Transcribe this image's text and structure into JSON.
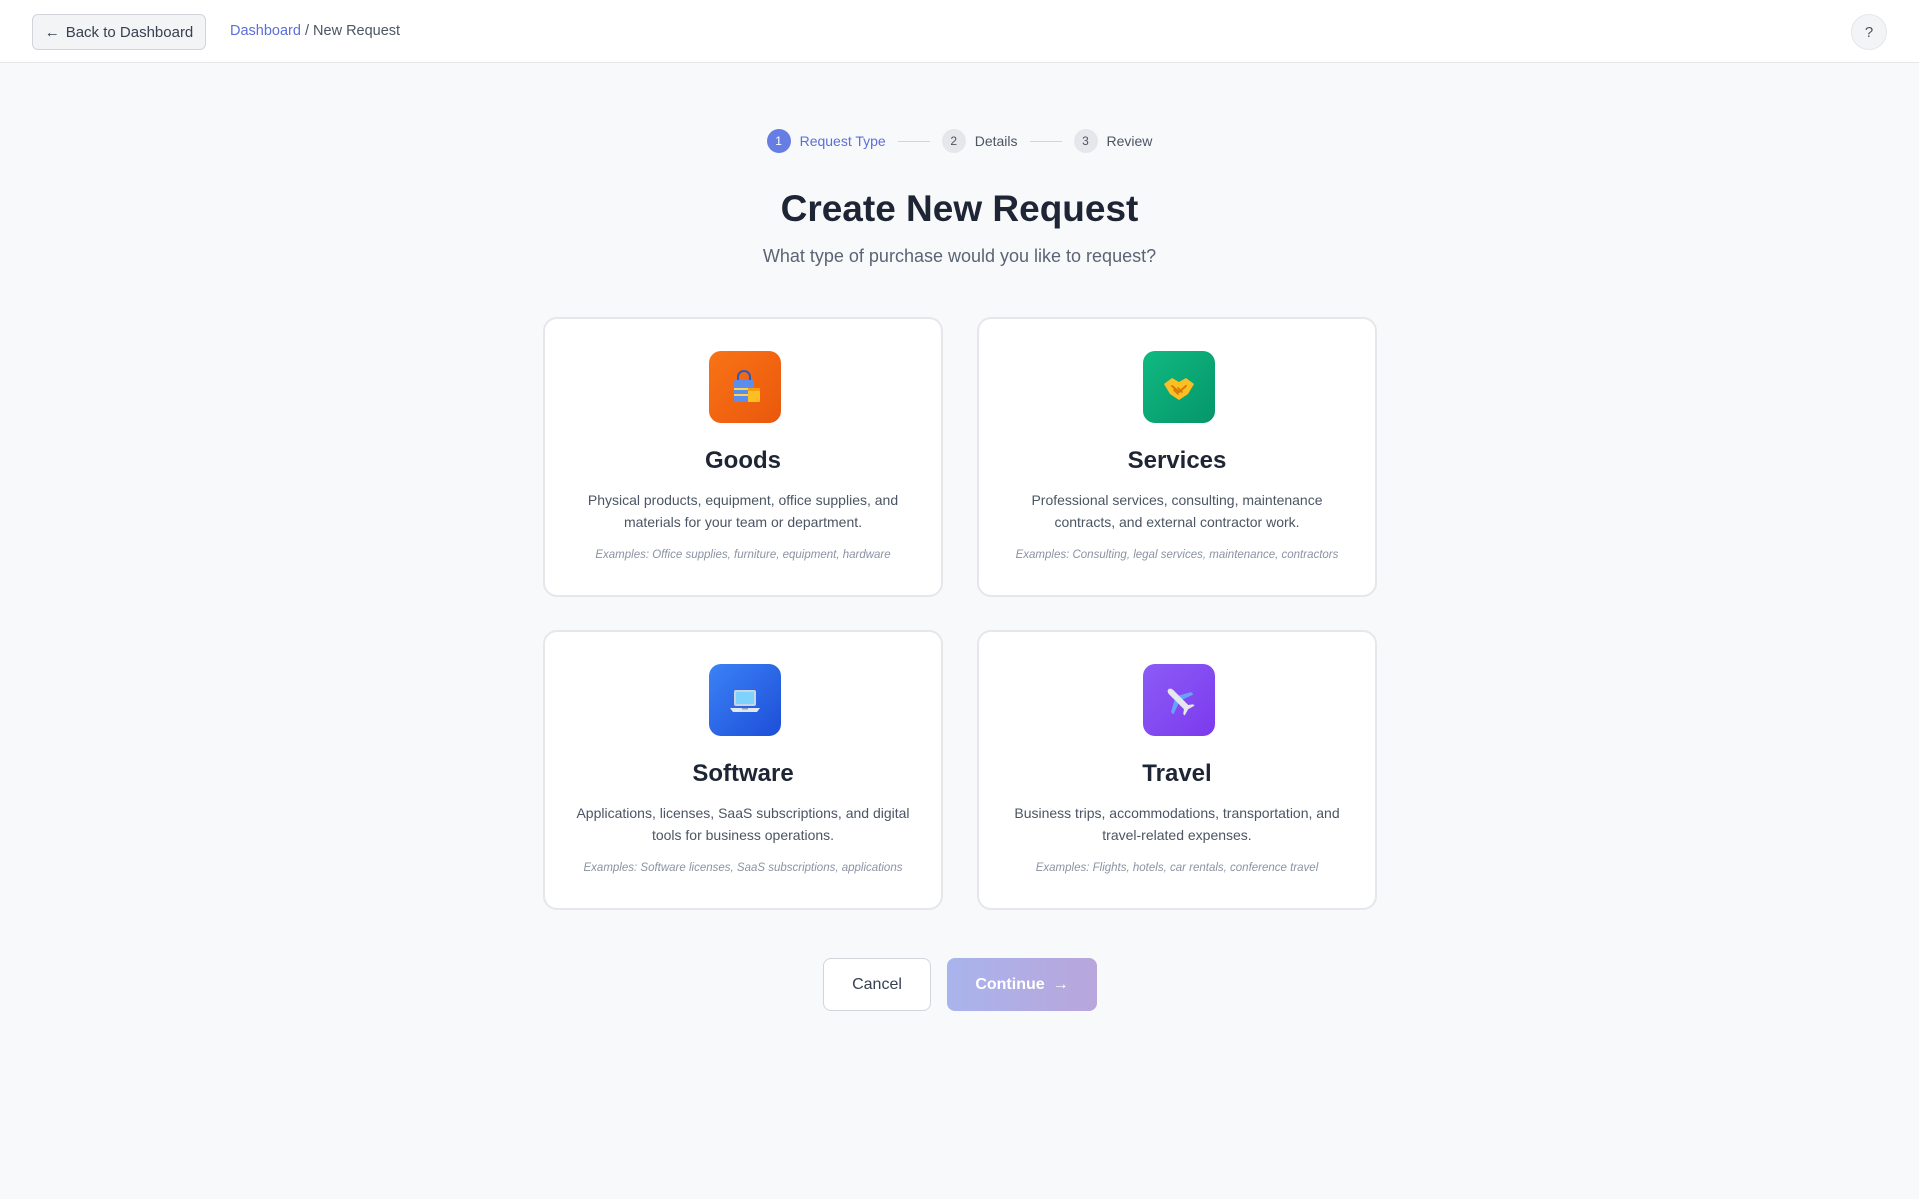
{
  "header": {
    "back_button": {
      "arrow": "←",
      "label": "Back to Dashboard"
    },
    "breadcrumb": {
      "link": "Dashboard",
      "separator": "/",
      "current": "New Request"
    },
    "help_label": "?"
  },
  "stepper": {
    "steps": [
      {
        "number": "1",
        "label": "Request Type",
        "active": true
      },
      {
        "number": "2",
        "label": "Details",
        "active": false
      },
      {
        "number": "3",
        "label": "Review",
        "active": false
      }
    ]
  },
  "page": {
    "title": "Create New Request",
    "subtitle": "What type of purchase would you like to request?"
  },
  "cards": [
    {
      "title": "Goods",
      "icon": "shopping-bag-icon",
      "color": "#f97316",
      "description": "Physical products, equipment, office supplies, and materials for your team or department.",
      "examples": "Examples: Office supplies, furniture, equipment, hardware"
    },
    {
      "title": "Services",
      "icon": "handshake-icon",
      "color": "#10b981",
      "description": "Professional services, consulting, maintenance contracts, and external contractor work.",
      "examples": "Examples: Consulting, legal services, maintenance, contractors"
    },
    {
      "title": "Software",
      "icon": "laptop-icon",
      "color": "#3b82f6",
      "description": "Applications, licenses, SaaS subscriptions, and digital tools for business operations.",
      "examples": "Examples: Software licenses, SaaS subscriptions, applications"
    },
    {
      "title": "Travel",
      "icon": "airplane-icon",
      "color": "#8b5cf6",
      "description": "Business trips, accommodations, transportation, and travel-related expenses.",
      "examples": "Examples: Flights, hotels, car rentals, conference travel"
    }
  ],
  "actions": {
    "cancel": "Cancel",
    "continue": "Continue",
    "continue_arrow": "→"
  },
  "colors": {
    "accent": "#667ee3",
    "background": "#f8f9fb"
  }
}
